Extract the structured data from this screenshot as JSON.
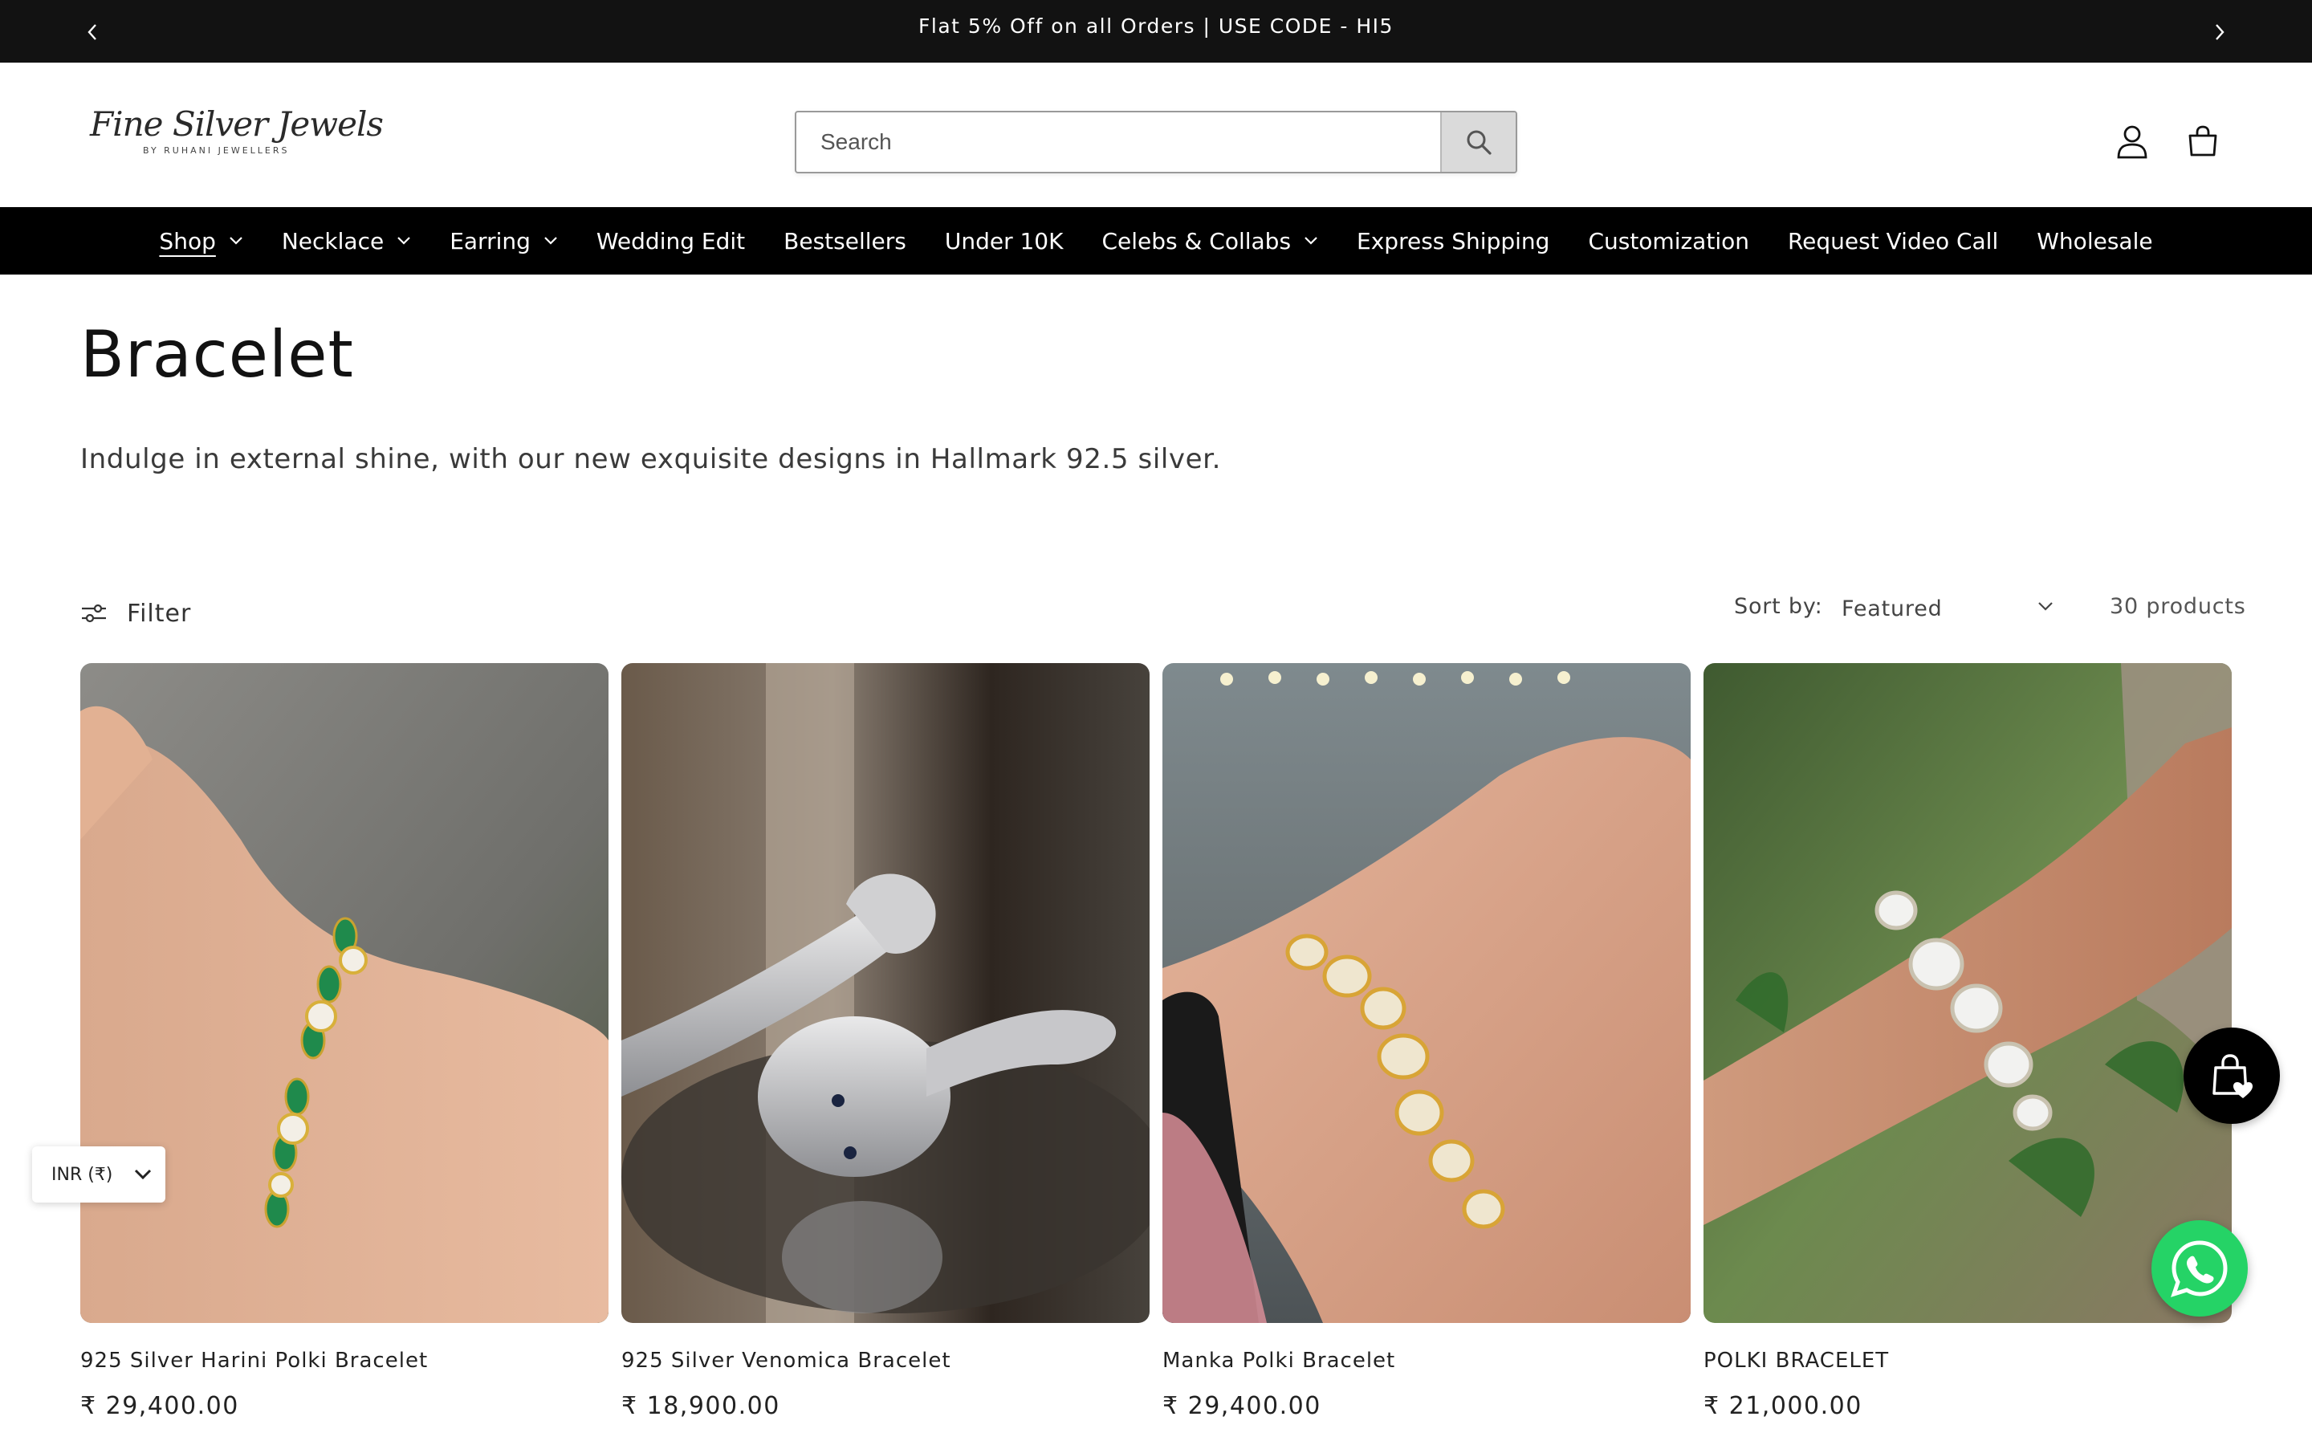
{
  "announcement": {
    "message": "Flat 5% Off on all Orders | USE CODE - HI5",
    "prev_icon": "chevron-left-icon",
    "next_icon": "chevron-right-icon"
  },
  "header": {
    "logo_script": "Fine Silver Jewels",
    "logo_sub": "BY RUHANI JEWELLERS",
    "search_placeholder": "Search",
    "search_icon": "search-icon",
    "account_icon": "account-icon",
    "cart_icon": "cart-icon"
  },
  "nav": {
    "items": [
      {
        "label": "Shop",
        "dropdown": true,
        "active": true
      },
      {
        "label": "Necklace",
        "dropdown": true
      },
      {
        "label": "Earring",
        "dropdown": true
      },
      {
        "label": "Wedding Edit",
        "dropdown": false
      },
      {
        "label": "Bestsellers",
        "dropdown": false
      },
      {
        "label": "Under 10K",
        "dropdown": false
      },
      {
        "label": "Celebs & Collabs",
        "dropdown": true
      },
      {
        "label": "Express Shipping",
        "dropdown": false
      },
      {
        "label": "Customization",
        "dropdown": false
      },
      {
        "label": "Request Video Call",
        "dropdown": false
      },
      {
        "label": "Wholesale",
        "dropdown": false
      }
    ]
  },
  "collection": {
    "title": "Bracelet",
    "description": "Indulge in external shine, with our new exquisite designs in Hallmark 92.5 silver."
  },
  "toolbar": {
    "filter_label": "Filter",
    "filter_icon": "sliders-icon",
    "sort_label": "Sort by:",
    "sort_value": "Featured",
    "product_count": "30 products"
  },
  "products": [
    {
      "name": "925 Silver Harini Polki Bracelet",
      "price": "₹ 29,400.00"
    },
    {
      "name": "925 Silver Venomica Bracelet",
      "price": "₹ 18,900.00"
    },
    {
      "name": "Manka Polki Bracelet",
      "price": "₹ 29,400.00"
    },
    {
      "name": "POLKI BRACELET",
      "price": "₹ 21,000.00"
    }
  ],
  "widgets": {
    "currency": "INR (₹)",
    "wishlist_icon": "shopping-bag-heart-icon",
    "whatsapp_icon": "whatsapp-icon"
  },
  "colors": {
    "bar_background": "#121212",
    "nav_background": "#000000",
    "whatsapp_green": "#25d366"
  }
}
